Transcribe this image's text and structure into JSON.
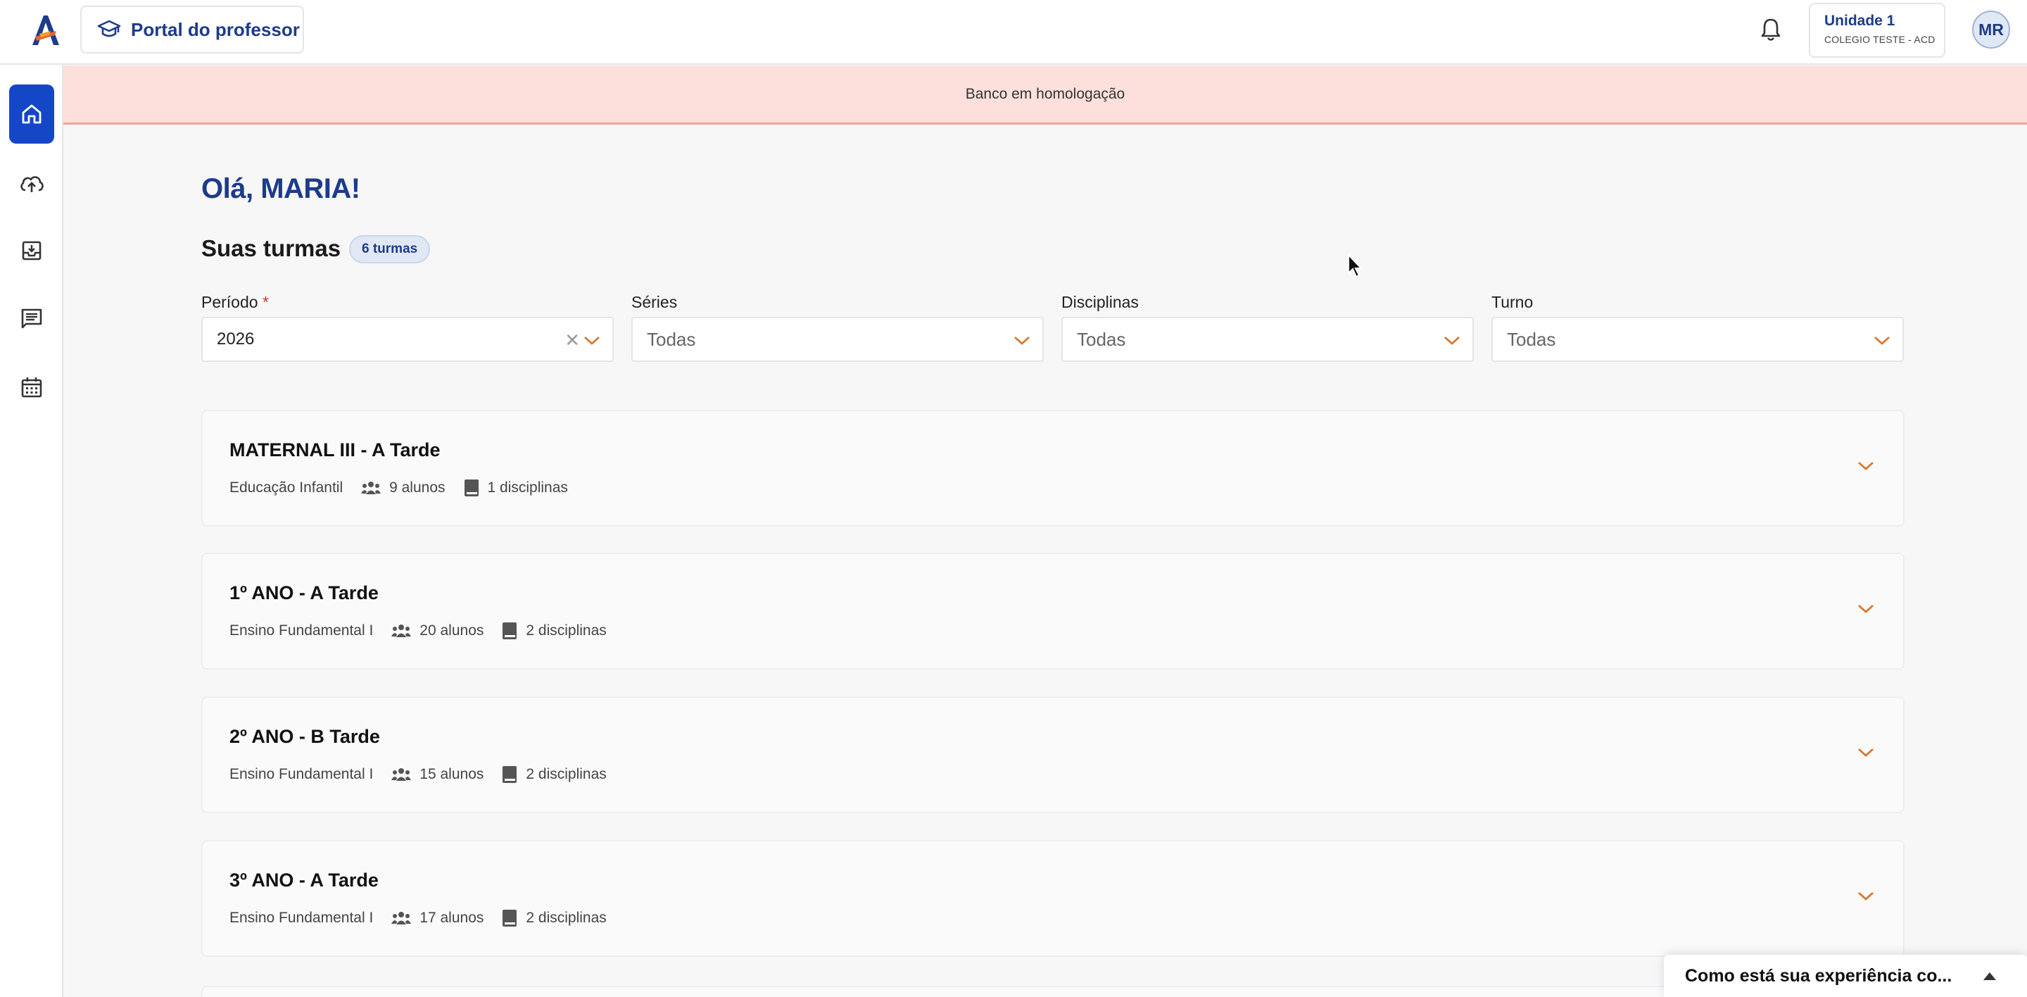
{
  "header": {
    "portal_label": "Portal do professor",
    "unit_title": "Unidade 1",
    "unit_subtitle": "COLEGIO TESTE - ACD",
    "avatar_initials": "MR",
    "brand_color": "#1d3b8a"
  },
  "sidebar": {
    "items": [
      {
        "name": "home",
        "icon": "home-icon",
        "active": true
      },
      {
        "name": "upload",
        "icon": "cloud-upload-icon",
        "active": false
      },
      {
        "name": "archive",
        "icon": "archive-download-icon",
        "active": false
      },
      {
        "name": "messages",
        "icon": "message-list-icon",
        "active": false
      },
      {
        "name": "calendar",
        "icon": "calendar-icon",
        "active": false
      }
    ]
  },
  "banner": {
    "text": "Banco em homologação"
  },
  "main": {
    "greeting": "Olá, MARIA!",
    "section_title": "Suas turmas",
    "count_badge": "6 turmas",
    "filters": [
      {
        "label": "Período",
        "required": true,
        "value": "2026",
        "placeholder": false,
        "clearable": true
      },
      {
        "label": "Séries",
        "required": false,
        "value": "Todas",
        "placeholder": true,
        "clearable": false
      },
      {
        "label": "Disciplinas",
        "required": false,
        "value": "Todas",
        "placeholder": true,
        "clearable": false
      },
      {
        "label": "Turno",
        "required": false,
        "value": "Todas",
        "placeholder": true,
        "clearable": false
      }
    ],
    "classes": [
      {
        "title": "MATERNAL III - A Tarde",
        "level": "Educação Infantil",
        "students": "9 alunos",
        "subjects": "1 disciplinas"
      },
      {
        "title": "1º ANO - A Tarde",
        "level": "Ensino Fundamental I",
        "students": "20 alunos",
        "subjects": "2 disciplinas"
      },
      {
        "title": "2º ANO - B Tarde",
        "level": "Ensino Fundamental I",
        "students": "15 alunos",
        "subjects": "2 disciplinas"
      },
      {
        "title": "3º ANO - A Tarde",
        "level": "Ensino Fundamental I",
        "students": "17 alunos",
        "subjects": "2 disciplinas"
      }
    ]
  },
  "feedback": {
    "text": "Como está sua experiência co..."
  },
  "colors": {
    "accent_orange": "#d9772f",
    "active_blue": "#1446c8"
  }
}
